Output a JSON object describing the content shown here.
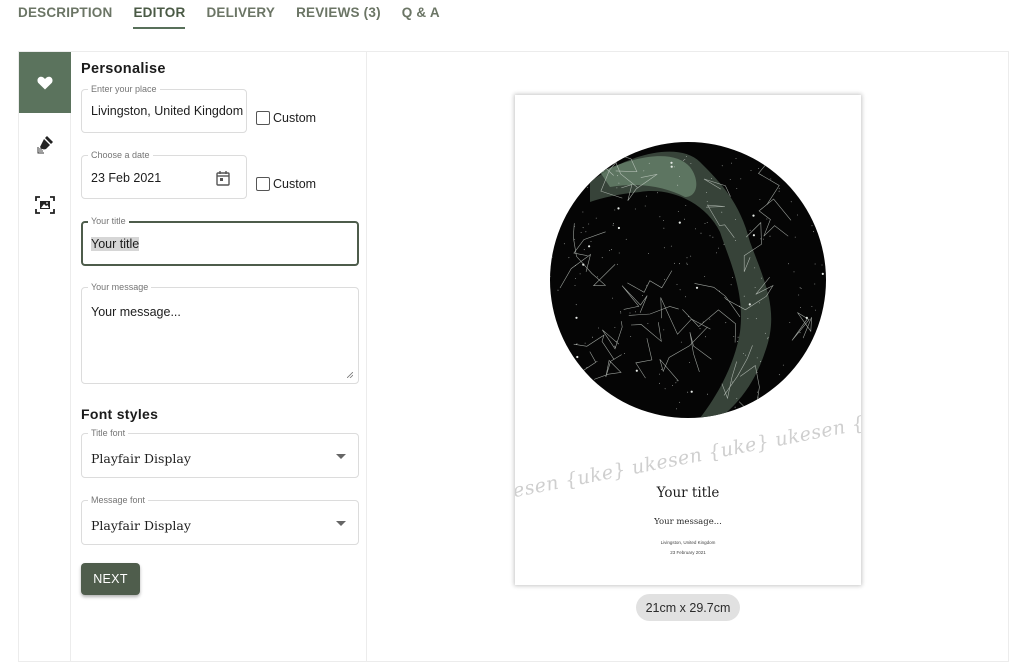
{
  "tabs": [
    {
      "label": "DESCRIPTION",
      "active": false
    },
    {
      "label": "EDITOR",
      "active": true
    },
    {
      "label": "DELIVERY",
      "active": false
    },
    {
      "label": "REVIEWS (3)",
      "active": false
    },
    {
      "label": "Q & A",
      "active": false
    }
  ],
  "rail": [
    {
      "icon": "heart-icon",
      "active": true
    },
    {
      "icon": "paint-brush-icon",
      "active": false
    },
    {
      "icon": "image-frame-icon",
      "active": false
    }
  ],
  "personalise": {
    "heading": "Personalise",
    "place": {
      "label": "Enter your place",
      "value": "Livingston, United Kingdom",
      "custom_label": "Custom",
      "custom_checked": false
    },
    "date": {
      "label": "Choose a date",
      "value": "23 Feb 2021",
      "custom_label": "Custom",
      "custom_checked": false
    },
    "title": {
      "label": "Your title",
      "value": "Your title",
      "focused": true
    },
    "message": {
      "label": "Your message",
      "value": "Your message..."
    }
  },
  "font_styles": {
    "heading": "Font styles",
    "title_font": {
      "label": "Title font",
      "value": "Playfair Display"
    },
    "message_font": {
      "label": "Message font",
      "value": "Playfair Display"
    }
  },
  "next_button": "NEXT",
  "preview": {
    "watermark": "ukesen {uke} ukesen {uke} ukesen {uke} ukesen",
    "title": "Your title",
    "message": "Your message...",
    "place": "Livingston, United Kingdom",
    "date": "23 February 2021",
    "size": "21cm x 29.7cm"
  },
  "colors": {
    "accent": "#5b735d",
    "button": "#4f5d4c",
    "skymap_bg": "#050505",
    "milky_way": "#5f7a63"
  }
}
